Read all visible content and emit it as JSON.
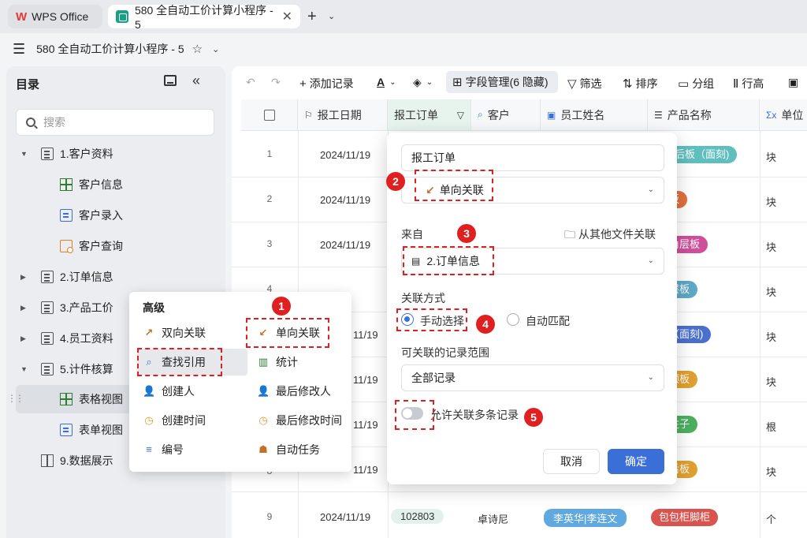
{
  "tabs": [
    {
      "label": "WPS Office"
    },
    {
      "label": "580 全自动工价计算小程序 - 5"
    }
  ],
  "window_title": "580 全自动工价计算小程序 - 5",
  "sidebar": {
    "title": "目录",
    "search_placeholder": "搜索",
    "items": [
      {
        "label": "1.客户资料"
      },
      {
        "label": "客户信息"
      },
      {
        "label": "客户录入"
      },
      {
        "label": "客户查询"
      },
      {
        "label": "2.订单信息"
      },
      {
        "label": "3.产品工价"
      },
      {
        "label": "4.员工资料"
      },
      {
        "label": "5.计件核算"
      },
      {
        "label": "表格视图"
      },
      {
        "label": "表单视图"
      },
      {
        "label": "9.数据展示"
      }
    ]
  },
  "toolbar": {
    "add_record": "添加记录",
    "field_manage": "字段管理(6 隐藏)",
    "filter": "筛选",
    "sort": "排序",
    "group": "分组",
    "row_height": "行高"
  },
  "table": {
    "headers": [
      "报工日期",
      "报工订单",
      "客户",
      "员工姓名",
      "产品名称",
      "单位"
    ],
    "rows": [
      {
        "num": "1",
        "date": "2024/11/19",
        "product": "后板（面刻)",
        "unit": "块"
      },
      {
        "num": "2",
        "date": "2024/11/19",
        "product": "层板",
        "unit": "块"
      },
      {
        "num": "3",
        "date": "2024/11/19",
        "product": "转角层板",
        "unit": "块"
      },
      {
        "num": "4",
        "date": "",
        "product": "柜层板",
        "unit": "块"
      },
      {
        "num": "",
        "date": "11/19",
        "product": "板（面刻)",
        "unit": "块"
      },
      {
        "num": "",
        "date": "11/19",
        "product": "柜顶板",
        "unit": "块"
      },
      {
        "num": "",
        "date": "11/19",
        "product": "柜柱子",
        "unit": "根"
      },
      {
        "num": "8",
        "date": "11/19",
        "product": "柜后板",
        "unit": "块"
      },
      {
        "num": "9",
        "date": "2024/11/19",
        "order": "102803",
        "customer": "卓诗尼",
        "employee": "李英华|李连文",
        "product": "包包柜脚柜",
        "unit": "个"
      }
    ],
    "tag_colors": [
      "#5fbfbf",
      "#e0703c",
      "#d04f9a",
      "#5fa8c7",
      "#4a6fcf",
      "#e0a030",
      "#4caf60",
      "#e0a030",
      "#d9534f"
    ]
  },
  "context_menu": {
    "title": "高级",
    "items": [
      "双向关联",
      "单向关联",
      "查找引用",
      "统计",
      "创建人",
      "最后修改人",
      "创建时间",
      "最后修改时间",
      "编号",
      "自动任务"
    ]
  },
  "dialog": {
    "field_name": "报工订单",
    "field_type": "单向关联",
    "source_label": "来自",
    "other_file_link": "从其他文件关联",
    "source_value": "2.订单信息",
    "link_mode_label": "关联方式",
    "mode_manual": "手动选择",
    "mode_auto": "自动匹配",
    "range_label": "可关联的记录范围",
    "range_value": "全部记录",
    "allow_multi": "允许关联多条记录",
    "cancel": "取消",
    "ok": "确定"
  },
  "annotations": [
    "1",
    "2",
    "3",
    "4",
    "5"
  ]
}
